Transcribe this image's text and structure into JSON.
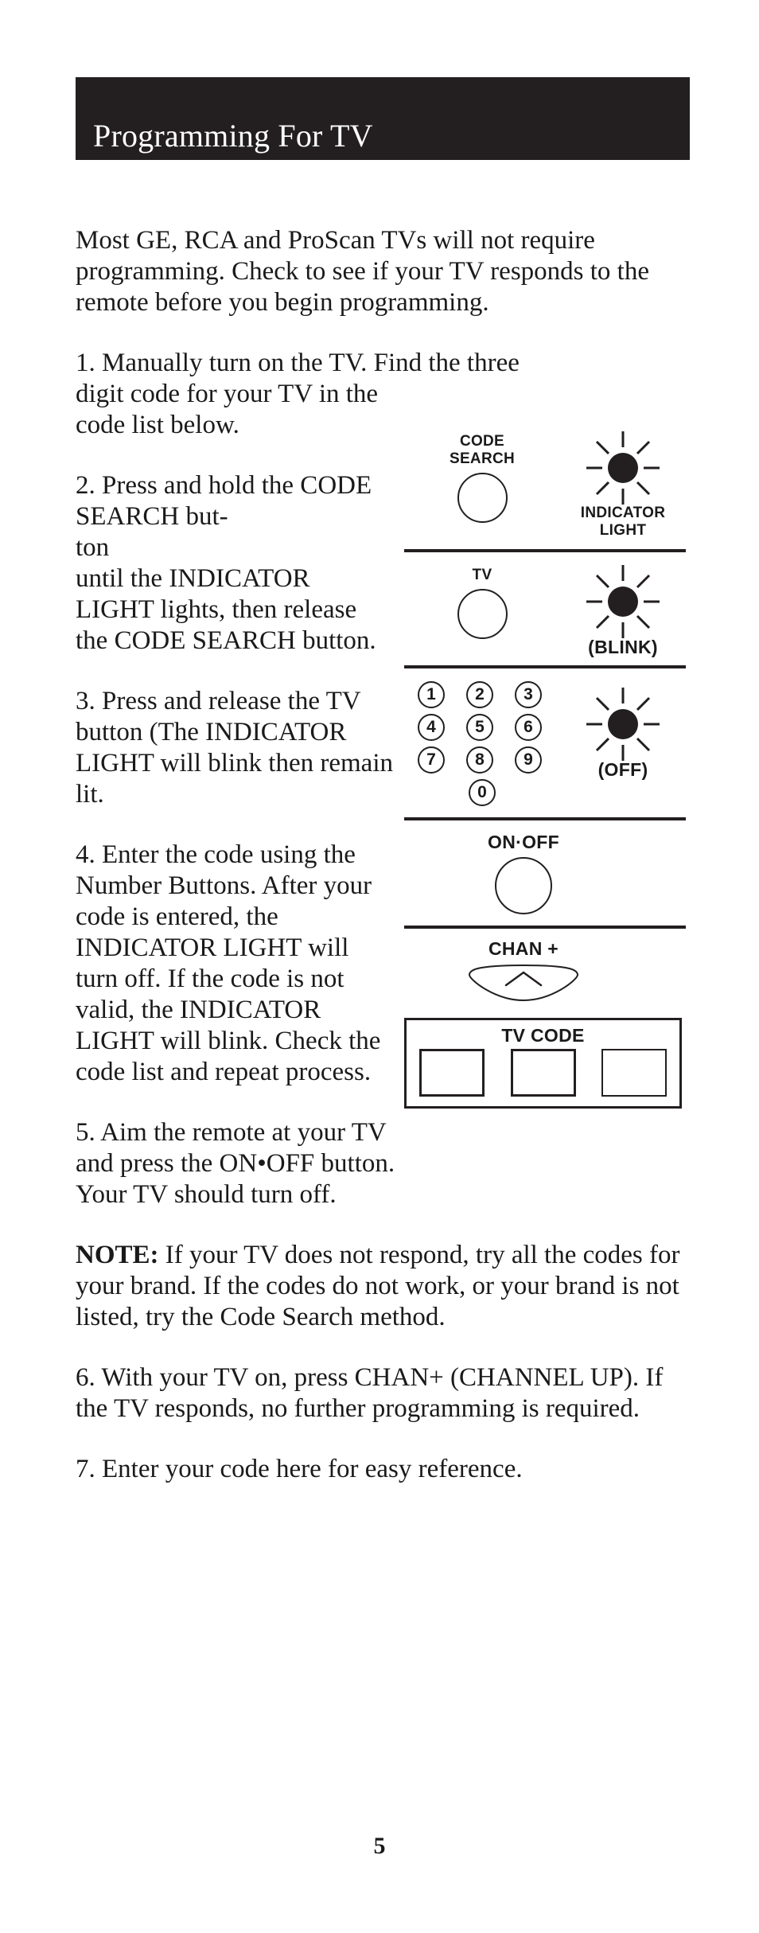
{
  "header": {
    "title": "Programming For TV",
    "bar_color": "#231f20",
    "text_color": "#ffffff"
  },
  "intro": "Most GE, RCA and ProScan TVs will not require programming. Check to see if your TV responds to the remote before you begin programming.",
  "steps": {
    "step1_lead": "1.    Manually turn on the TV. Find the three",
    "step1_rest": "digit code for your TV in the code list below.",
    "step2": "2.    Press and hold the CODE SEARCH but-",
    "step2_cont_a": "ton",
    "step2_cont_b": "until the INDICATOR LIGHT lights, then release the CODE SEARCH button.",
    "step3": "3.    Press and release the TV button (The INDICATOR LIGHT will blink then remain lit.",
    "step4": "4.    Enter the code using the Number Buttons. After your code is entered, the INDICATOR LIGHT will turn off. If the code is not valid, the INDICATOR LIGHT will blink. Check the code list and repeat process.",
    "step5": "5.    Aim the remote at your TV and press the ON•OFF button. Your TV should turn off.",
    "note_label": "NOTE:",
    "note_text": " If your TV does not respond, try all the codes for your brand. If the codes do not work, or your brand is not listed, try the Code Search method.",
    "step6": "6.    With your TV on, press CHAN+ (CHANNEL UP). If the TV responds, no further programming is required.",
    "step7": "7.    Enter your code here for easy reference."
  },
  "diagrams": {
    "panel1": {
      "button_label_line1": "CODE",
      "button_label_line2": "SEARCH",
      "indicator_label_line1": "INDICATOR",
      "indicator_label_line2": "LIGHT"
    },
    "panel2": {
      "button_label": "TV",
      "indicator_label": "(BLINK)"
    },
    "panel3": {
      "keys": [
        "1",
        "2",
        "3",
        "4",
        "5",
        "6",
        "7",
        "8",
        "9"
      ],
      "key_zero": "0",
      "indicator_label": "(OFF)"
    },
    "panel4": {
      "button_label": "ON·OFF"
    },
    "panel5": {
      "button_label": "CHAN +"
    },
    "panel6": {
      "title": "TV CODE",
      "slots": [
        "",
        "",
        ""
      ]
    }
  },
  "footer": {
    "page_number": "5"
  }
}
